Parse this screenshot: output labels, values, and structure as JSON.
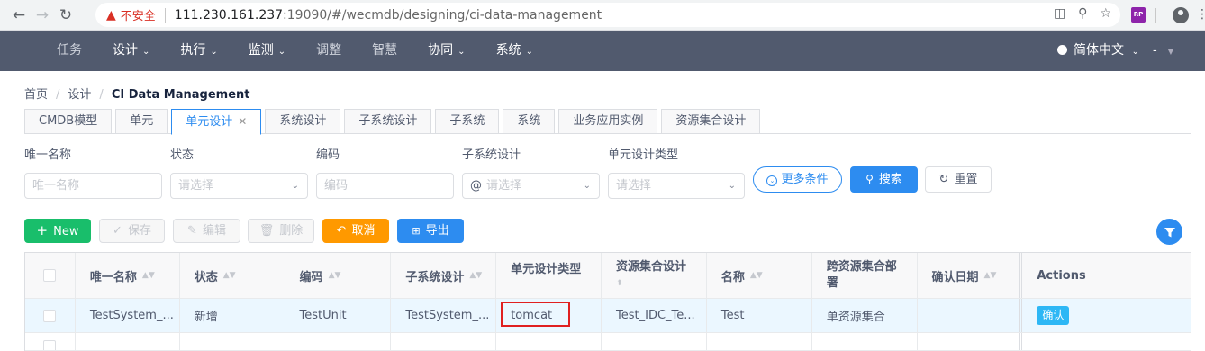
{
  "browser": {
    "security_label": "不安全",
    "url_host": "111.230.161.237",
    "url_rest": ":19090/#/wecmdb/designing/ci-data-management",
    "ext_label": "RP"
  },
  "header": {
    "menu": [
      {
        "label": "任务",
        "has_dropdown": false
      },
      {
        "label": "设计",
        "has_dropdown": true
      },
      {
        "label": "执行",
        "has_dropdown": true
      },
      {
        "label": "监测",
        "has_dropdown": true
      },
      {
        "label": "调整",
        "has_dropdown": false
      },
      {
        "label": "智慧",
        "has_dropdown": false
      },
      {
        "label": "协同",
        "has_dropdown": true
      },
      {
        "label": "系统",
        "has_dropdown": true
      }
    ],
    "language": "简体中文",
    "user": "-"
  },
  "breadcrumb": {
    "items": [
      "首页",
      "设计"
    ],
    "current": "CI Data Management"
  },
  "tabs": [
    {
      "label": "CMDB模型",
      "active": false
    },
    {
      "label": "单元",
      "active": false
    },
    {
      "label": "单元设计",
      "active": true,
      "closable": true
    },
    {
      "label": "系统设计",
      "active": false
    },
    {
      "label": "子系统设计",
      "active": false
    },
    {
      "label": "子系统",
      "active": false
    },
    {
      "label": "系统",
      "active": false
    },
    {
      "label": "业务应用实例",
      "active": false
    },
    {
      "label": "资源集合设计",
      "active": false
    }
  ],
  "filters": {
    "unique_name": {
      "label": "唯一名称",
      "placeholder": "唯一名称"
    },
    "status": {
      "label": "状态",
      "placeholder": "请选择"
    },
    "code": {
      "label": "编码",
      "placeholder": "编码"
    },
    "subsystem_design": {
      "label": "子系统设计",
      "placeholder": "请选择",
      "prefix": "@"
    },
    "unit_design_type": {
      "label": "单元设计类型",
      "placeholder": "请选择"
    },
    "more_label": "更多条件",
    "search_label": "搜索",
    "reset_label": "重置"
  },
  "toolbar": {
    "new_label": "New",
    "save_label": "保存",
    "edit_label": "编辑",
    "delete_label": "删除",
    "cancel_label": "取消",
    "export_label": "导出"
  },
  "table": {
    "columns": [
      "唯一名称",
      "状态",
      "编码",
      "子系统设计",
      "单元设计类型",
      "资源集合设计",
      "名称",
      "跨资源集合部署",
      "确认日期",
      "Actions"
    ],
    "column_sub": {
      "resource_set_design": "⬍",
      "cross_deploy_line2": "署"
    },
    "rows": [
      {
        "unique_name": "TestSystem_...",
        "status": "新增",
        "code": "TestUnit",
        "subsystem_design": "TestSystem_...",
        "unit_type": "tomcat",
        "resource_set": "Test_IDC_Te...",
        "name": "Test",
        "cross_deploy": "单资源集合",
        "confirm_date": "",
        "action": "确认"
      }
    ]
  },
  "colors": {
    "primary": "#2d8cf0",
    "success": "#19be6b",
    "warning": "#ff9900",
    "header_bg": "#515a6e",
    "highlight_box": "#e02020"
  }
}
